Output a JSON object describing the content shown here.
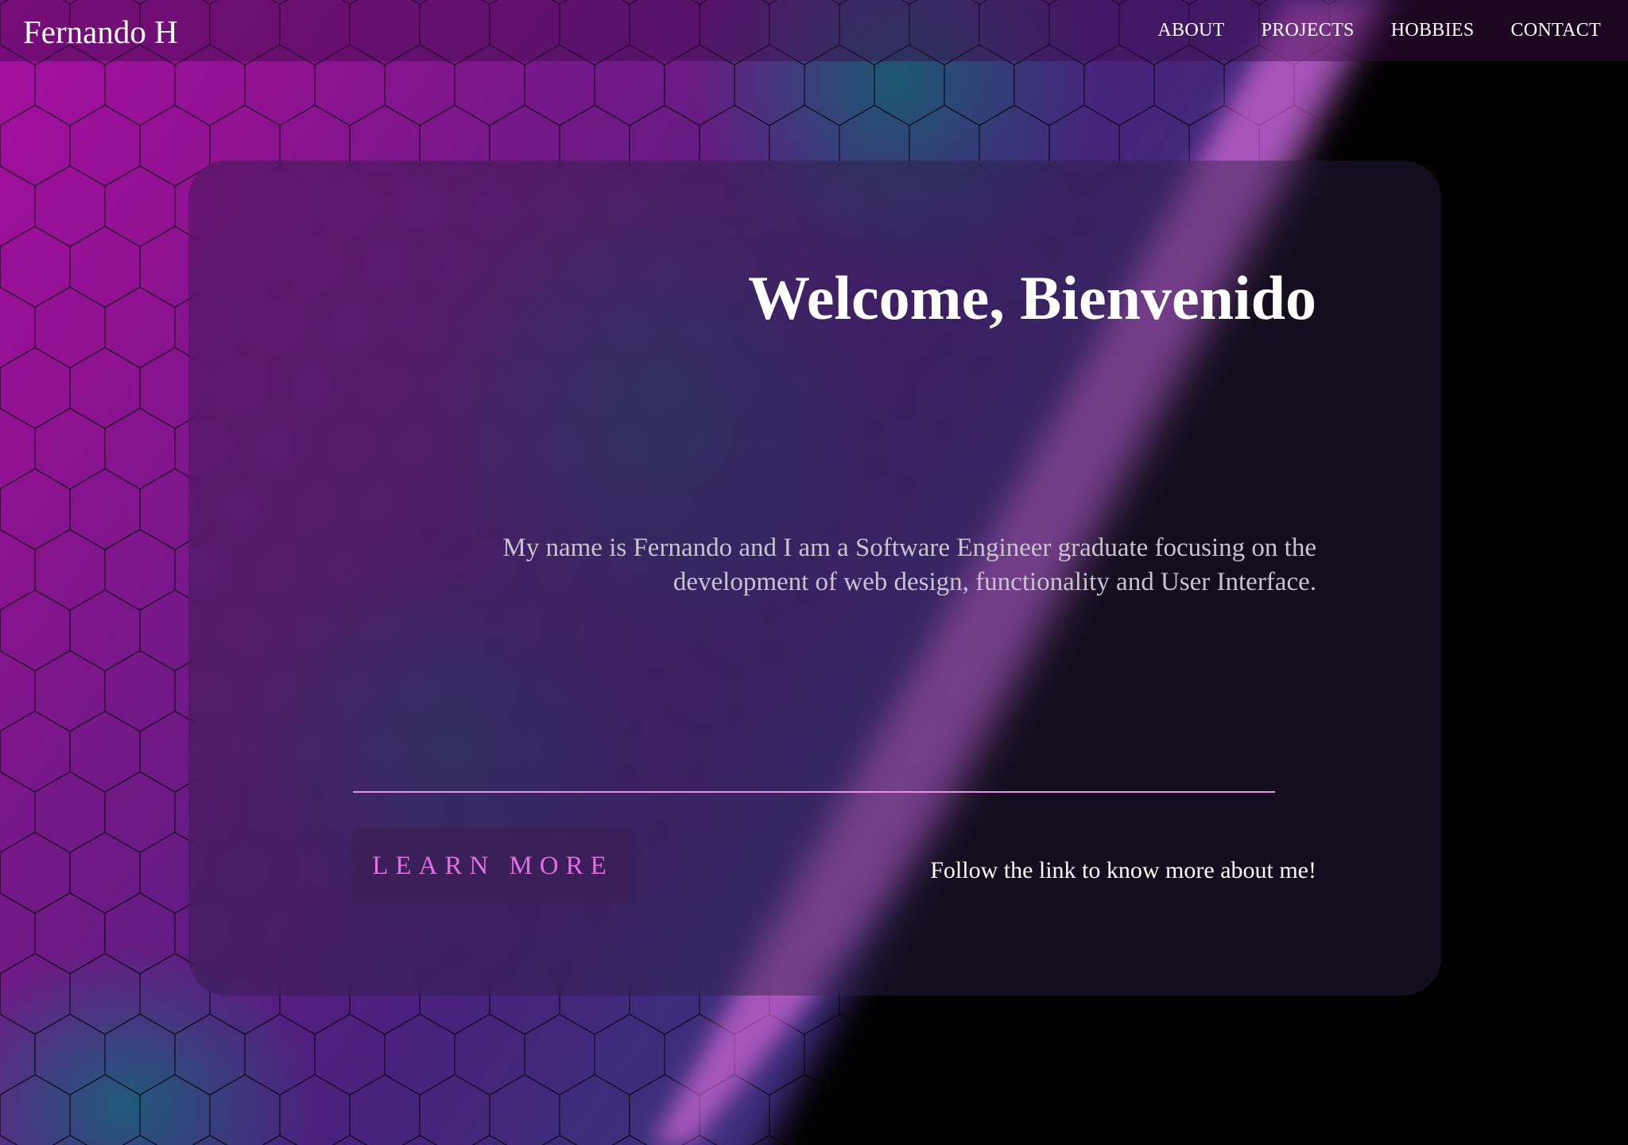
{
  "brand": {
    "name": "Fernando H"
  },
  "nav": {
    "items": [
      {
        "label": "ABOUT"
      },
      {
        "label": "PROJECTS"
      },
      {
        "label": "HOBBIES"
      },
      {
        "label": "CONTACT"
      }
    ]
  },
  "hero": {
    "headline": "Welcome, Bienvenido",
    "intro": "My name is Fernando and I am a Software Engineer graduate focusing on the development of web design, functionality and User Interface.",
    "cta_label": "LEARN MORE",
    "follow_text": "Follow the link to know more about me!"
  },
  "colors": {
    "accent_magenta": "#ff14e8",
    "accent_teal": "#00bea8",
    "cta_text": "#e070e0",
    "divider": "#e890e8",
    "background": "#000000"
  }
}
